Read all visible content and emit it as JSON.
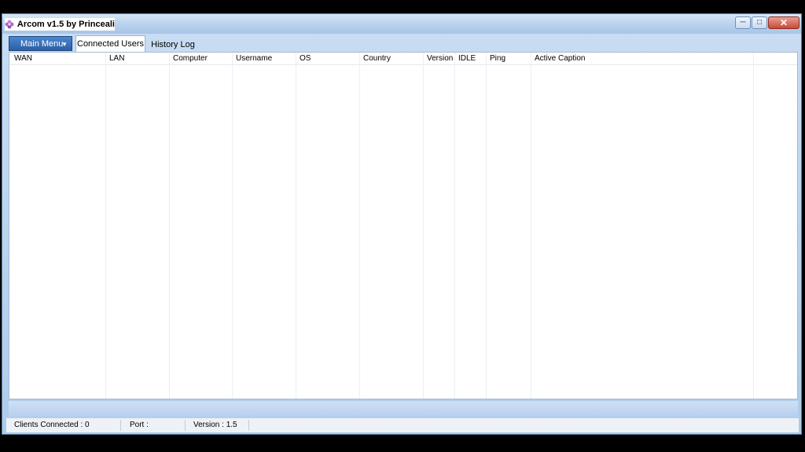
{
  "window": {
    "title": "Arcom v1.5 by Princeali"
  },
  "icons": {
    "app": "purple-flower-icon",
    "minimize": "minimize-icon",
    "maximize": "maximize-icon",
    "close": "close-icon",
    "dropdown": "caret-down-icon"
  },
  "menu": {
    "main_menu_label": "Main Menu"
  },
  "tabs": [
    {
      "label": "Connected Users",
      "active": true
    },
    {
      "label": "History Log",
      "active": false
    }
  ],
  "table": {
    "columns": [
      "WAN",
      "LAN",
      "Computer",
      "Username",
      "OS",
      "Country",
      "Version",
      "IDLE",
      "Ping",
      "Active Caption"
    ],
    "rows": []
  },
  "status": {
    "clients_connected": "Clients Connected : 0",
    "port": "Port :",
    "version": "Version : 1.5"
  },
  "colors": {
    "accent": "#2b5ea5",
    "close": "#c84a36",
    "frame": "#aecbea"
  }
}
